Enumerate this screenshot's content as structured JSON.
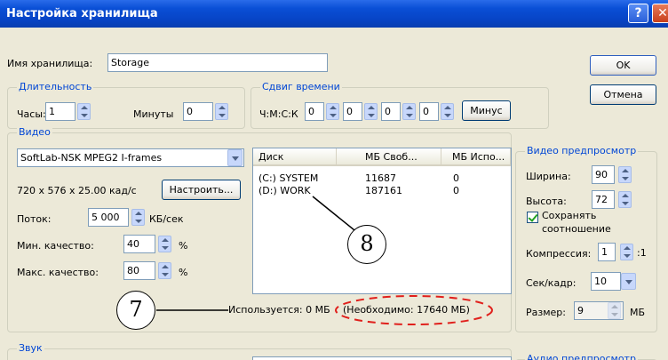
{
  "window": {
    "title": "Настройка хранилища"
  },
  "storage": {
    "name_label": "Имя хранилища:",
    "name_value": "Storage"
  },
  "buttons": {
    "ok": "OK",
    "cancel": "Отмена",
    "minus": "Минус",
    "configure": "Настроить..."
  },
  "duration": {
    "group_title": "Длительность",
    "hours_label": "Часы:",
    "hours_value": "1",
    "minutes_label": "Минуты",
    "minutes_value": "0"
  },
  "time_shift": {
    "group_title": "Сдвиг времени",
    "format_label": "Ч:М:С:К",
    "values": [
      "0",
      "0",
      "0",
      "0"
    ]
  },
  "video": {
    "group_title": "Видео",
    "codec": "SoftLab-NSK MPEG2 I-frames",
    "format": "720 x 576 x 25.00 кад/с",
    "stream_label": "Поток:",
    "stream_value": "5 000",
    "stream_unit": "КБ/сек",
    "min_quality_label": "Мин. качество:",
    "min_quality_value": "40",
    "max_quality_label": "Макс. качество:",
    "max_quality_value": "80",
    "percent": "%"
  },
  "disks": {
    "columns": [
      "Диск",
      "МБ Своб...",
      "МБ Испо..."
    ],
    "rows": [
      {
        "disk": "(C:) SYSTEM",
        "free": "11687",
        "used": "0"
      },
      {
        "disk": "(D:) WORK",
        "free": "187161",
        "used": "0"
      }
    ]
  },
  "usage": {
    "used_text": "Используется: 0 МБ",
    "required_text": "(Необходимо: 17640 МБ)"
  },
  "preview": {
    "group_title": "Видео предпросмотр",
    "width_label": "Ширина:",
    "width_value": "90",
    "height_label": "Высота:",
    "height_value": "72",
    "keep_ratio_line1": "Сохранять",
    "keep_ratio_line2": "соотношение",
    "compression_label": "Компрессия:",
    "compression_value": "1",
    "compression_suffix": ":1",
    "sec_frame_label": "Сек/кадр:",
    "sec_frame_value": "10",
    "size_label": "Размер:",
    "size_value": "9",
    "size_unit": "МБ"
  },
  "sound": {
    "group_title": "Звук"
  },
  "audio_preview": {
    "group_title": "Аудио предпросмотр"
  },
  "callouts": {
    "seven": "7",
    "eight": "8"
  },
  "colors": {
    "title_bar": "#0a4fd6",
    "group_title": "#0046d5",
    "dialog_bg": "#ece9d8",
    "callout_dash": "#e0201c"
  }
}
